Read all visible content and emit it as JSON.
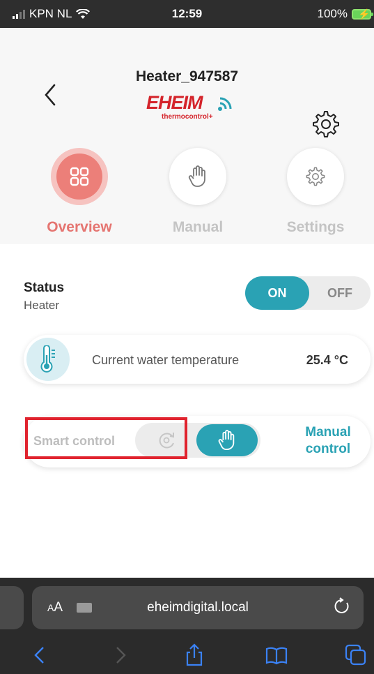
{
  "status_bar": {
    "carrier": "KPN NL",
    "time": "12:59",
    "battery": "100%"
  },
  "header": {
    "back_icon": "chevron-left-icon",
    "title": "Heater_947587",
    "logo_text": "EHEIM",
    "logo_sub": "thermocontrol+",
    "settings_icon": "gear-icon"
  },
  "tabs": [
    {
      "label": "Overview",
      "icon": "grid-icon",
      "active": true
    },
    {
      "label": "Manual",
      "icon": "hand-icon",
      "active": false
    },
    {
      "label": "Settings",
      "icon": "gear-icon",
      "active": false
    }
  ],
  "status": {
    "title": "Status",
    "subtitle": "Heater",
    "on_label": "ON",
    "off_label": "OFF",
    "state": "ON"
  },
  "temperature": {
    "label": "Current water temperature",
    "value": "25.4 °C",
    "icon": "thermometer-icon"
  },
  "control": {
    "smart_label": "Smart control",
    "manual_label_line1": "Manual",
    "manual_label_line2": "control",
    "selected": "manual"
  },
  "colors": {
    "accent": "#2aa2b4",
    "tab_active": "#ec7f79",
    "highlight": "#e0232e",
    "brand": "#d4232a"
  },
  "browser": {
    "text_size": "AA",
    "url": "eheimdigital.local"
  }
}
